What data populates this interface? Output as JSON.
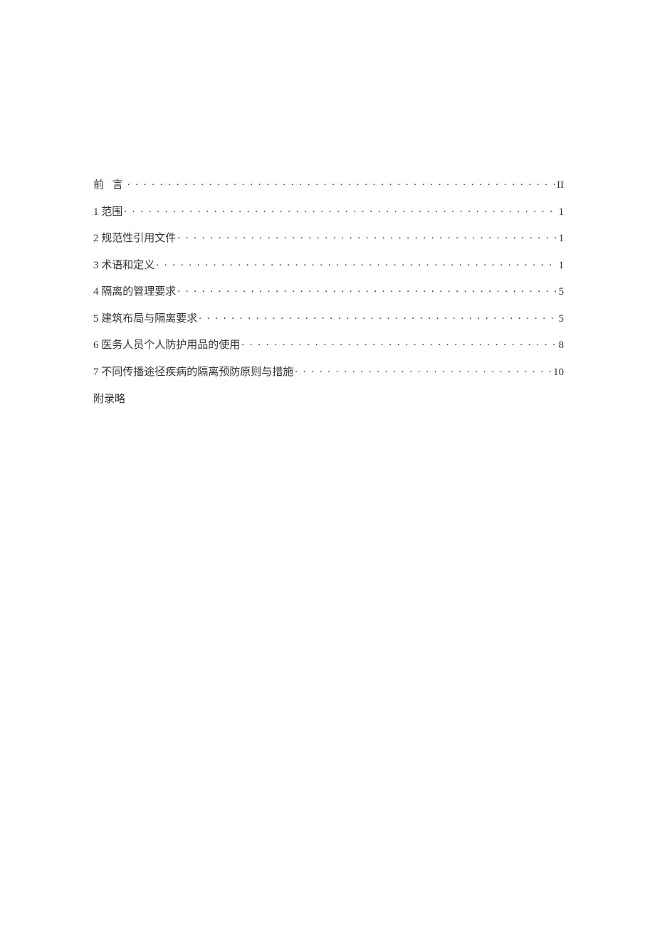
{
  "toc": [
    {
      "title": "前 言",
      "page": "II",
      "spaced": true
    },
    {
      "title": "1 范围",
      "page": "1",
      "spaced": false
    },
    {
      "title": "2 规范性引用文件",
      "page": "1",
      "spaced": false
    },
    {
      "title": "3 术语和定义",
      "page": "1",
      "spaced": false
    },
    {
      "title": "4 隔离的管理要求",
      "page": "5",
      "spaced": false
    },
    {
      "title": "5 建筑布局与隔离要求",
      "page": "5",
      "spaced": false
    },
    {
      "title": "6 医务人员个人防护用品的使用",
      "page": "8",
      "spaced": false
    },
    {
      "title": "7 不同传播途径疾病的隔离预防原则与措施",
      "page": "10",
      "spaced": false
    }
  ],
  "appendix": "附录略"
}
